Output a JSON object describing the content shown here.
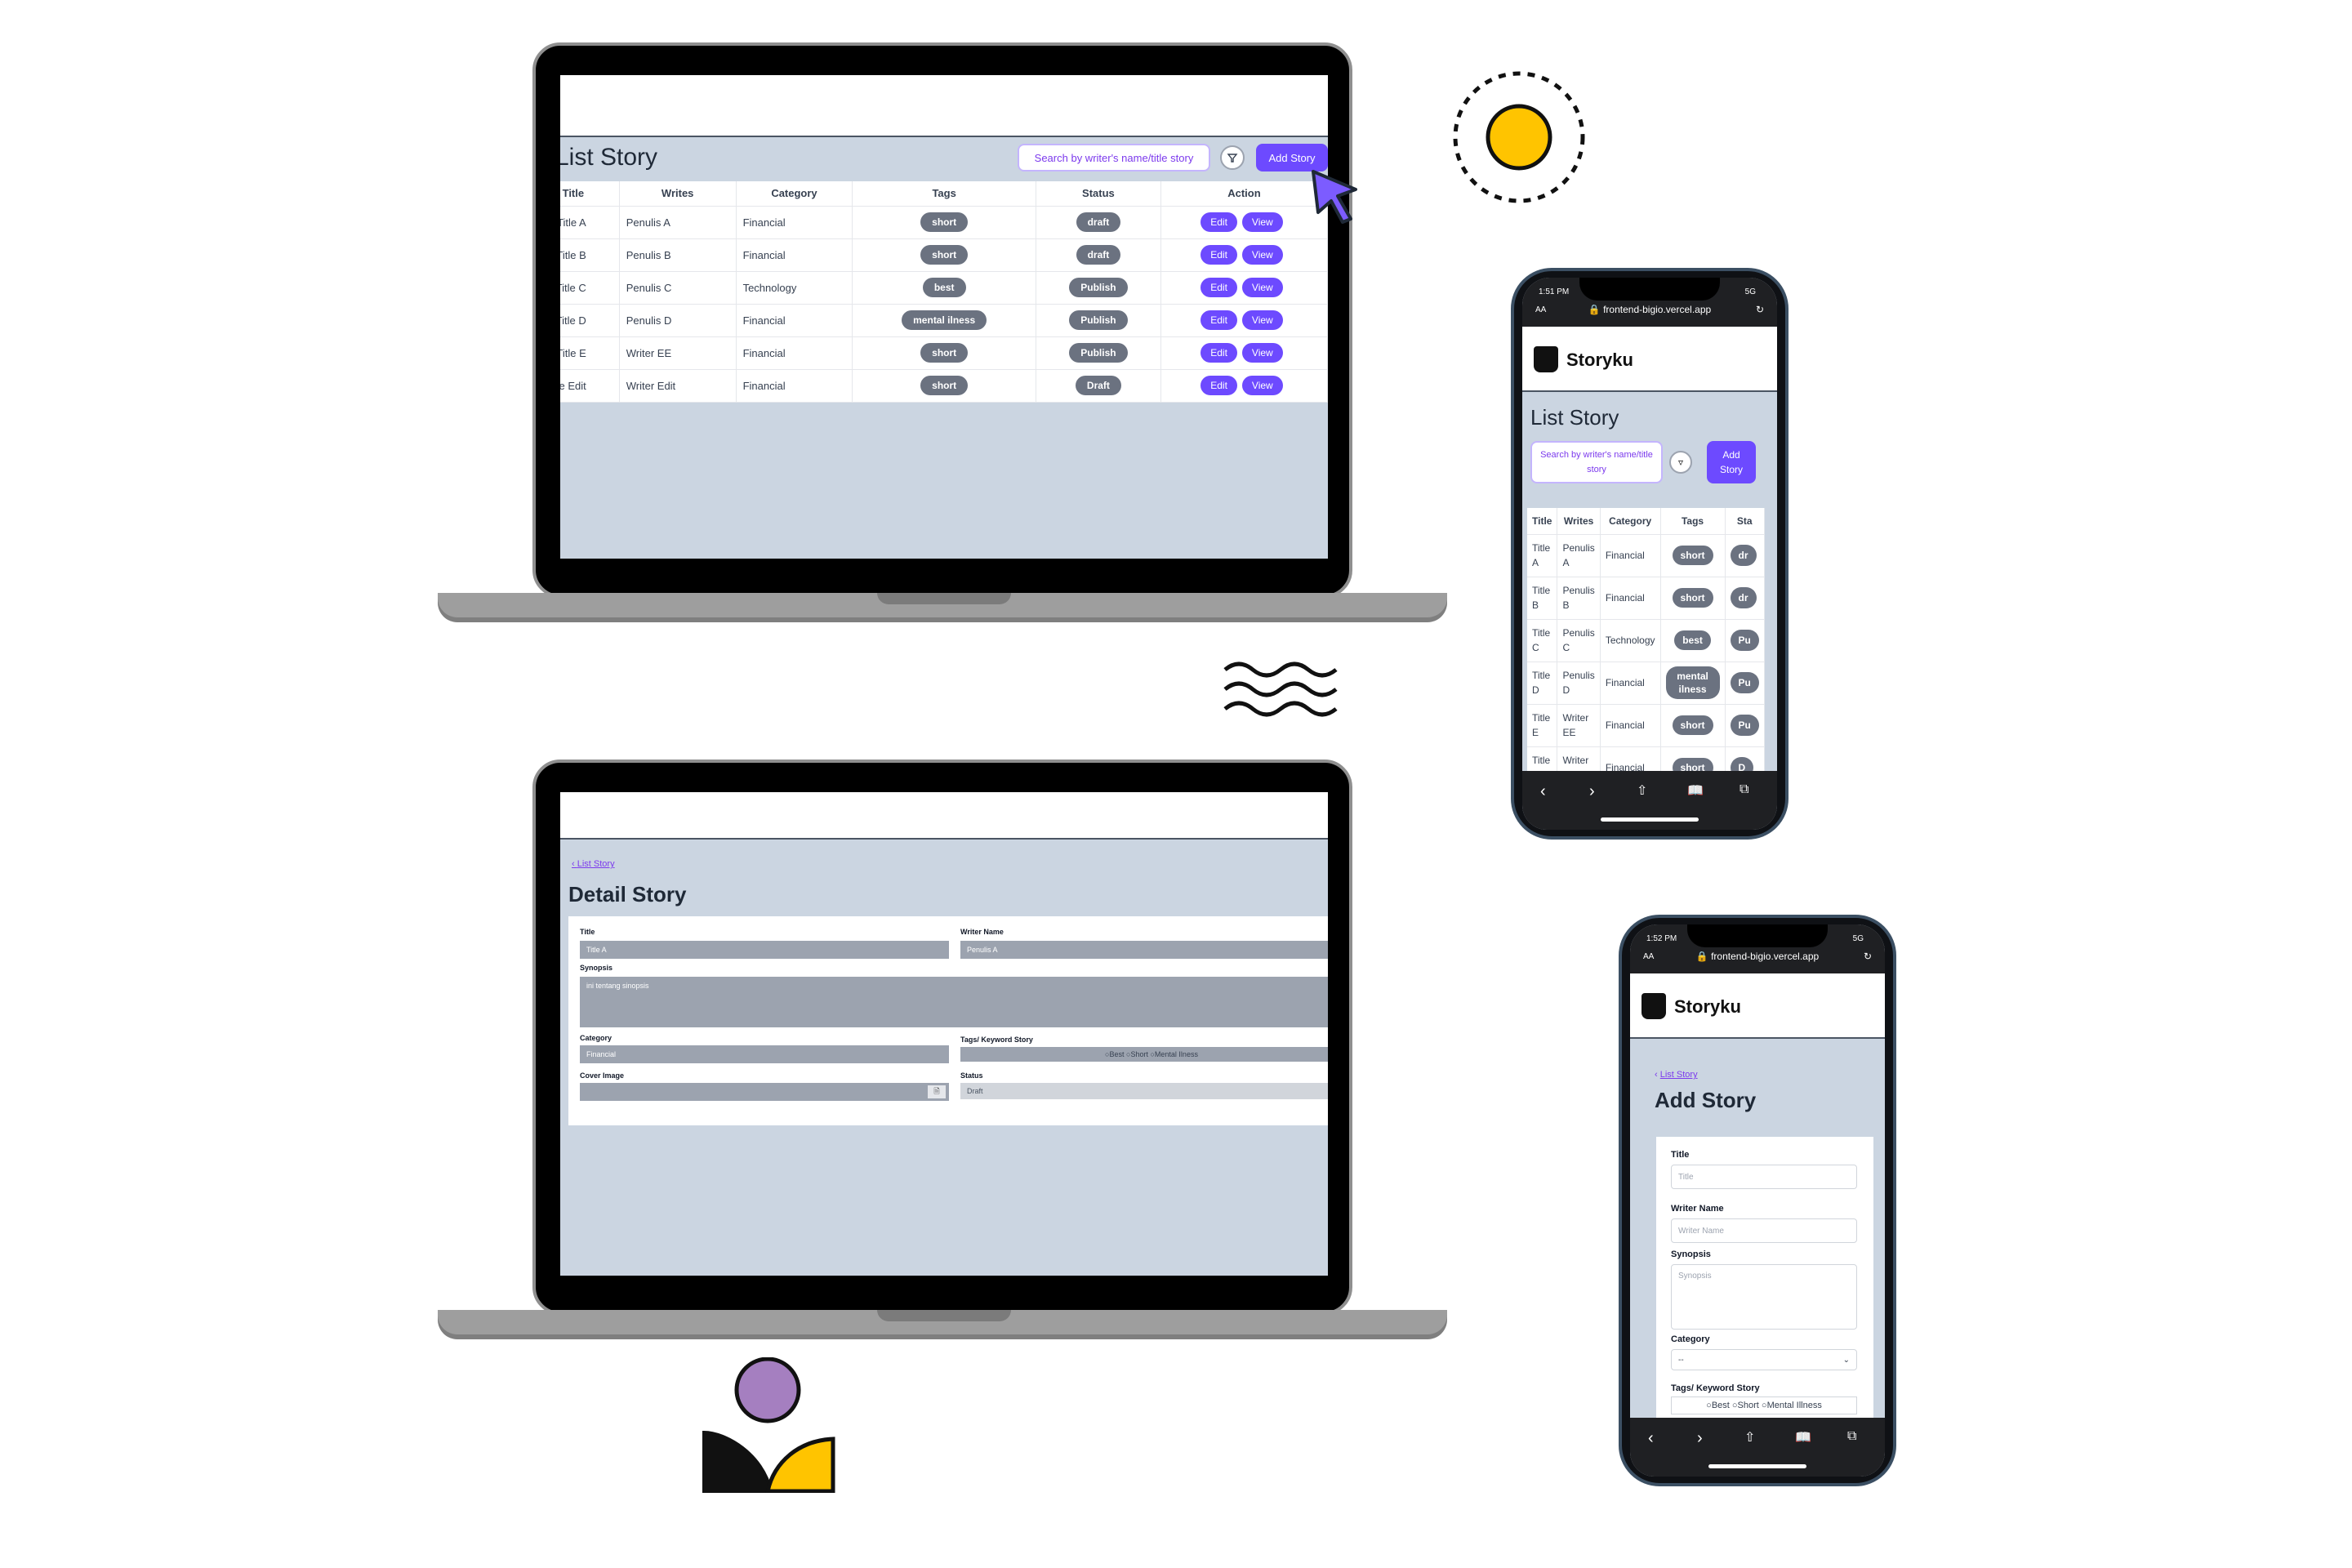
{
  "list_story": {
    "title": "List Story",
    "search_placeholder": "Search by writer's name/title story",
    "add_label": "Add Story",
    "filter_icon": "filter-icon",
    "columns": [
      "Title",
      "Writes",
      "Category",
      "Tags",
      "Status",
      "Action"
    ],
    "rows": [
      {
        "title": "Title A",
        "writer": "Penulis A",
        "category": "Financial",
        "tag": "short",
        "status": "draft"
      },
      {
        "title": "Title B",
        "writer": "Penulis B",
        "category": "Financial",
        "tag": "short",
        "status": "draft"
      },
      {
        "title": "Title C",
        "writer": "Penulis C",
        "category": "Technology",
        "tag": "best",
        "status": "Publish"
      },
      {
        "title": "Title D",
        "writer": "Penulis D",
        "category": "Financial",
        "tag": "mental ilness",
        "status": "Publish"
      },
      {
        "title": "Title E",
        "writer": "Writer EE",
        "category": "Financial",
        "tag": "short",
        "status": "Publish"
      },
      {
        "title": "Title Edit",
        "writer": "Writer Edit",
        "category": "Financial",
        "tag": "short",
        "status": "Draft"
      }
    ],
    "edit_label": "Edit",
    "view_label": "View"
  },
  "detail_story": {
    "back_label": "List Story",
    "title": "Detail Story",
    "title_label": "Title",
    "title_value": "Title A",
    "writer_label": "Writer Name",
    "writer_value": "Penulis A",
    "synopsis_label": "Synopsis",
    "synopsis_value": "ini tentang sinopsis",
    "category_label": "Category",
    "category_value": "Financial",
    "tags_label": "Tags/ Keyword Story",
    "tag_options": [
      "Best",
      "Short",
      "Mental Ilness"
    ],
    "cover_label": "Cover Image",
    "status_label": "Status",
    "status_value": "Draft"
  },
  "phone1": {
    "time": "1:51 PM",
    "signal": "5G",
    "url": "frontend-bigio.vercel.app",
    "text_size": "AA",
    "brand": "Storyku",
    "title": "List Story",
    "search_placeholder": "Search by writer's name/title story",
    "add_label": "Add Story",
    "columns": [
      "Title",
      "Writes",
      "Category",
      "Tags",
      "Sta"
    ],
    "rows": [
      {
        "title": "Title A",
        "writer": "Penulis A",
        "category": "Financial",
        "tag": "short",
        "status": "dr"
      },
      {
        "title": "Title B",
        "writer": "Penulis B",
        "category": "Financial",
        "tag": "short",
        "status": "dr"
      },
      {
        "title": "Title C",
        "writer": "Penulis C",
        "category": "Technology",
        "tag": "best",
        "status": "Pu"
      },
      {
        "title": "Title D",
        "writer": "Penulis D",
        "category": "Financial",
        "tag": "mental ilness",
        "status": "Pu"
      },
      {
        "title": "Title E",
        "writer": "Writer EE",
        "category": "Financial",
        "tag": "short",
        "status": "Pu"
      },
      {
        "title": "Title Edit",
        "writer": "Writer Edit",
        "category": "Financial",
        "tag": "short",
        "status": "D"
      }
    ]
  },
  "phone2": {
    "time": "1:52 PM",
    "signal": "5G",
    "url": "frontend-bigio.vercel.app",
    "text_size": "AA",
    "brand": "Storyku",
    "back_label": "List Story",
    "title": "Add Story",
    "title_label": "Title",
    "title_placeholder": "Title",
    "writer_label": "Writer Name",
    "writer_placeholder": "Writer Name",
    "synopsis_label": "Synopsis",
    "synopsis_placeholder": "Synopsis",
    "category_label": "Category",
    "category_value": "--",
    "tags_label": "Tags/ Keyword Story",
    "tag_options": [
      "Best",
      "Short",
      "Mental Illness"
    ]
  },
  "colors": {
    "accent": "#6d4aff",
    "page_bg": "#cbd5e1",
    "pill": "#6b7280",
    "yellow": "#ffc400",
    "purple": "#a57fc0"
  }
}
